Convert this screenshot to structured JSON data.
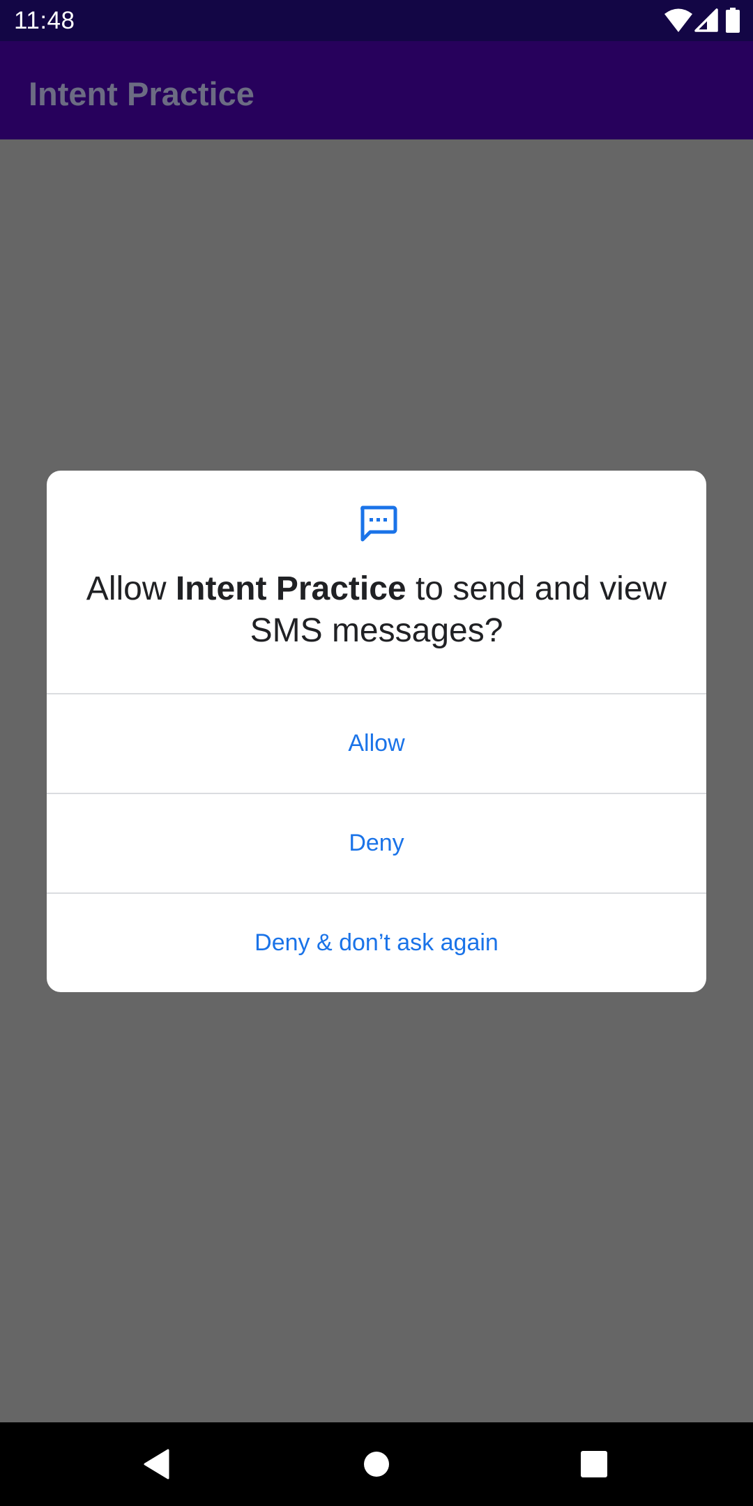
{
  "status_bar": {
    "time": "11:48",
    "icons": [
      "wifi-icon",
      "signal-icon",
      "battery-icon"
    ]
  },
  "app_bar": {
    "title": "Intent Practice"
  },
  "dialog": {
    "icon": "sms-icon",
    "message_prefix": "Allow ",
    "app_name": "Intent Practice",
    "message_suffix": " to send and view SMS messages?",
    "buttons": {
      "allow": "Allow",
      "deny": "Deny",
      "deny_dont_ask": "Deny & don’t ask again"
    }
  },
  "nav_bar": {
    "icons": [
      "back-icon",
      "home-icon",
      "recents-icon"
    ]
  },
  "colors": {
    "status_bar": "#130645",
    "app_bar": "#27015c",
    "scrim": "#666666",
    "accent": "#1a73e8",
    "dialog_text": "#202124"
  }
}
